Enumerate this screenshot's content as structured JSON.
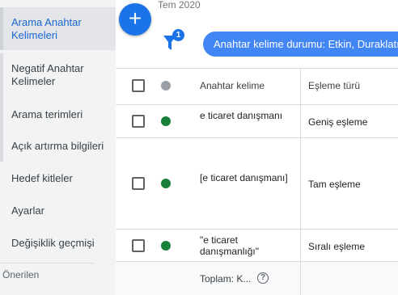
{
  "sidebar": {
    "items": [
      {
        "label": "Arama Anahtar Kelimeleri"
      },
      {
        "label": "Negatif Anahtar Kelimeler"
      },
      {
        "label": "Arama terimleri"
      },
      {
        "label": "Açık artırma bilgileri"
      },
      {
        "label": "Hedef kitleler"
      },
      {
        "label": "Ayarlar"
      },
      {
        "label": "Değişiklik geçmişi"
      }
    ],
    "section_label": "Önerilen"
  },
  "header": {
    "date_label": "Tem 2020",
    "add_button_label": "+",
    "filter_count": "1",
    "filter_chip": "Anahtar kelime durumu: Etkin, Duraklatıldı"
  },
  "table": {
    "columns": [
      "Anahtar kelime",
      "Eşleme türü"
    ],
    "rows": [
      {
        "keyword": "e ticaret danışmanı",
        "match_type": "Geniş eşleme",
        "status_color": "#188038"
      },
      {
        "keyword": "[e ticaret danışmanı]",
        "match_type": "Tam eşleme",
        "status_color": "#188038"
      },
      {
        "keyword": "\"e ticaret danışmanlığı\"",
        "match_type": "Sıralı eşleme",
        "status_color": "#188038"
      }
    ],
    "total_label": "Toplam: K...",
    "help_glyph": "?"
  },
  "colors": {
    "accent": "#1a73e8",
    "chip": "#4285f4",
    "active_text": "#1967d2",
    "status_enabled": "#188038"
  }
}
